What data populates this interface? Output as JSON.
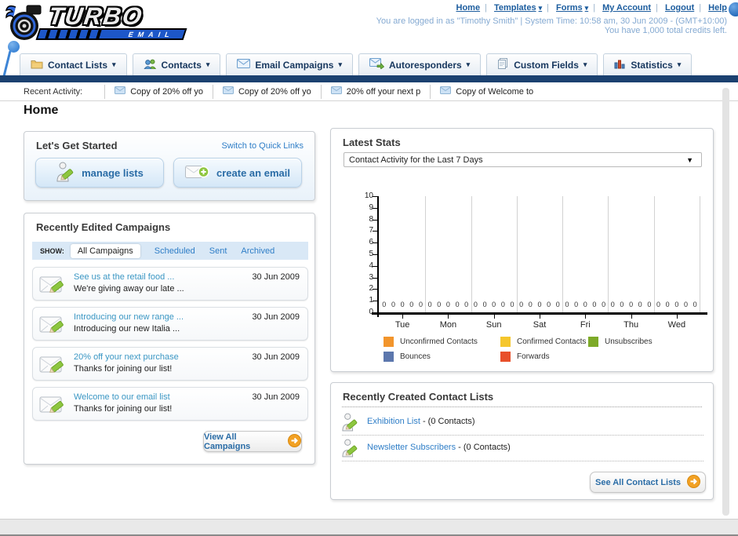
{
  "header": {
    "logo_title": "TURBO",
    "logo_subtitle": "EMAIL",
    "links": [
      "Home",
      "Templates",
      "Forms",
      "My Account",
      "Logout",
      "Help"
    ],
    "status_line1": "You are logged in as \"Timothy Smith\" | System Time: 10:58 am, 30 Jun 2009 - (GMT+10:00)",
    "status_line2": "You have 1,000 total credits left."
  },
  "nav": {
    "tabs": [
      {
        "label": "Contact Lists",
        "icon": "folder-icon"
      },
      {
        "label": "Contacts",
        "icon": "contacts-icon"
      },
      {
        "label": "Email Campaigns",
        "icon": "envelope-icon"
      },
      {
        "label": "Autoresponders",
        "icon": "envelope-arrow-icon"
      },
      {
        "label": "Custom Fields",
        "icon": "pages-icon"
      },
      {
        "label": "Statistics",
        "icon": "bar-chart-icon"
      }
    ]
  },
  "recent_activity": {
    "label": "Recent Activity:",
    "items": [
      "Copy of 20% off yo",
      "Copy of 20% off yo",
      "20% off your next p",
      "Copy of Welcome to"
    ]
  },
  "page_title": "Home",
  "get_started": {
    "title": "Let's Get Started",
    "switch_link": "Switch to Quick Links",
    "buttons": [
      {
        "label": "manage lists"
      },
      {
        "label": "create an email"
      }
    ]
  },
  "campaigns": {
    "title": "Recently Edited Campaigns",
    "show_label": "SHOW:",
    "active_filter": "All Campaigns",
    "filters": [
      "Scheduled",
      "Sent",
      "Archived"
    ],
    "items": [
      {
        "title": "See us at the retail food ...",
        "subtitle": "We're giving away our late ...",
        "date": "30 Jun 2009"
      },
      {
        "title": "Introducing our new range ...",
        "subtitle": "Introducing our new Italia ...",
        "date": "30 Jun 2009"
      },
      {
        "title": "20% off your next purchase",
        "subtitle": "Thanks for joining our list!",
        "date": "30 Jun 2009"
      },
      {
        "title": "Welcome to our email list",
        "subtitle": "Thanks for joining our list!",
        "date": "30 Jun 2009"
      }
    ],
    "view_all_label": "View All Campaigns"
  },
  "stats": {
    "title": "Latest Stats",
    "selected_option": "Contact Activity for the Last 7 Days"
  },
  "chart_data": {
    "type": "bar",
    "title": "Contact Activity for the Last 7 Days",
    "categories": [
      "Tue",
      "Mon",
      "Sun",
      "Sat",
      "Fri",
      "Thu",
      "Wed"
    ],
    "series": [
      {
        "name": "Unconfirmed Contacts",
        "color": "#f2952c",
        "values": [
          0,
          0,
          0,
          0,
          0,
          0,
          0
        ]
      },
      {
        "name": "Confirmed Contacts",
        "color": "#f5c62d",
        "values": [
          0,
          0,
          0,
          0,
          0,
          0,
          0
        ]
      },
      {
        "name": "Unsubscribes",
        "color": "#7daa28",
        "values": [
          0,
          0,
          0,
          0,
          0,
          0,
          0
        ]
      },
      {
        "name": "Bounces",
        "color": "#5c77ad",
        "values": [
          0,
          0,
          0,
          0,
          0,
          0,
          0
        ]
      },
      {
        "name": "Forwards",
        "color": "#e8502b",
        "values": [
          0,
          0,
          0,
          0,
          0,
          0,
          0
        ]
      }
    ],
    "xlabel": "",
    "ylabel": "",
    "ylim": [
      0,
      10
    ],
    "yticks": [
      0,
      1,
      2,
      3,
      4,
      5,
      6,
      7,
      8,
      9,
      10
    ],
    "grid": "vertical",
    "legend_position": "bottom"
  },
  "contact_lists": {
    "title": "Recently Created Contact Lists",
    "items": [
      {
        "name": "Exhibition List",
        "count": "- (0 Contacts)"
      },
      {
        "name": "Newsletter Subscribers",
        "count": "- (0 Contacts)"
      }
    ],
    "see_all_label": "See All Contact Lists"
  }
}
